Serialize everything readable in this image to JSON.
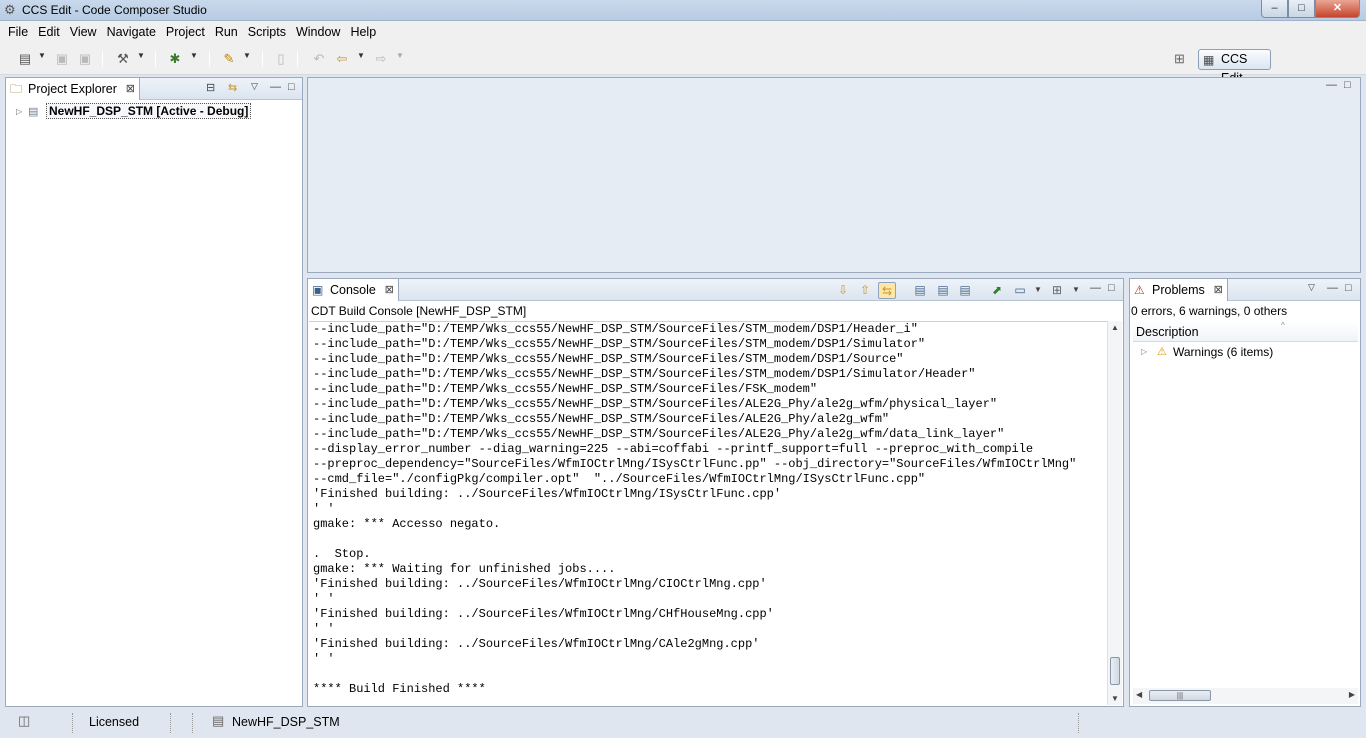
{
  "window": {
    "title": "CCS Edit - Code Composer Studio",
    "controls": {
      "minimize": "–",
      "maximize": "□",
      "close": "✕"
    }
  },
  "menubar": {
    "items": [
      "File",
      "Edit",
      "View",
      "Navigate",
      "Project",
      "Run",
      "Scripts",
      "Window",
      "Help"
    ]
  },
  "perspective": {
    "label": "CCS Edit"
  },
  "project_explorer": {
    "tab_label": "Project Explorer",
    "tree": [
      {
        "label": "NewHF_DSP_STM  [Active - Debug]",
        "expanded": false
      }
    ]
  },
  "console": {
    "tab_label": "Console",
    "subtitle": "CDT Build Console [NewHF_DSP_STM]",
    "lines": [
      "--include_path=\"D:/TEMP/Wks_ccs55/NewHF_DSP_STM/SourceFiles/STM_modem/DSP1/Header_i\"",
      "--include_path=\"D:/TEMP/Wks_ccs55/NewHF_DSP_STM/SourceFiles/STM_modem/DSP1/Simulator\"",
      "--include_path=\"D:/TEMP/Wks_ccs55/NewHF_DSP_STM/SourceFiles/STM_modem/DSP1/Source\"",
      "--include_path=\"D:/TEMP/Wks_ccs55/NewHF_DSP_STM/SourceFiles/STM_modem/DSP1/Simulator/Header\"",
      "--include_path=\"D:/TEMP/Wks_ccs55/NewHF_DSP_STM/SourceFiles/FSK_modem\"",
      "--include_path=\"D:/TEMP/Wks_ccs55/NewHF_DSP_STM/SourceFiles/ALE2G_Phy/ale2g_wfm/physical_layer\"",
      "--include_path=\"D:/TEMP/Wks_ccs55/NewHF_DSP_STM/SourceFiles/ALE2G_Phy/ale2g_wfm\"",
      "--include_path=\"D:/TEMP/Wks_ccs55/NewHF_DSP_STM/SourceFiles/ALE2G_Phy/ale2g_wfm/data_link_layer\"",
      "--display_error_number --diag_warning=225 --abi=coffabi --printf_support=full --preproc_with_compile",
      "--preproc_dependency=\"SourceFiles/WfmIOCtrlMng/ISysCtrlFunc.pp\" --obj_directory=\"SourceFiles/WfmIOCtrlMng\"",
      "--cmd_file=\"./configPkg/compiler.opt\"  \"../SourceFiles/WfmIOCtrlMng/ISysCtrlFunc.cpp\"",
      "'Finished building: ../SourceFiles/WfmIOCtrlMng/ISysCtrlFunc.cpp'",
      "' '",
      "gmake: *** Accesso negato.",
      "",
      ".  Stop.",
      "gmake: *** Waiting for unfinished jobs....",
      "'Finished building: ../SourceFiles/WfmIOCtrlMng/CIOCtrlMng.cpp'",
      "' '",
      "'Finished building: ../SourceFiles/WfmIOCtrlMng/CHfHouseMng.cpp'",
      "' '",
      "'Finished building: ../SourceFiles/WfmIOCtrlMng/CAle2gMng.cpp'",
      "' '",
      "",
      "**** Build Finished ****"
    ]
  },
  "problems": {
    "tab_label": "Problems",
    "summary": "0 errors, 6 warnings, 0 others",
    "column_header": "Description",
    "rows": [
      {
        "label": "Warnings (6 items)"
      }
    ]
  },
  "statusbar": {
    "license": "Licensed",
    "project": "NewHF_DSP_STM"
  },
  "icons": {
    "project_explorer": "folder-icon",
    "console": "console-icon",
    "problems": "problems-icon",
    "warning": "warning-icon"
  }
}
